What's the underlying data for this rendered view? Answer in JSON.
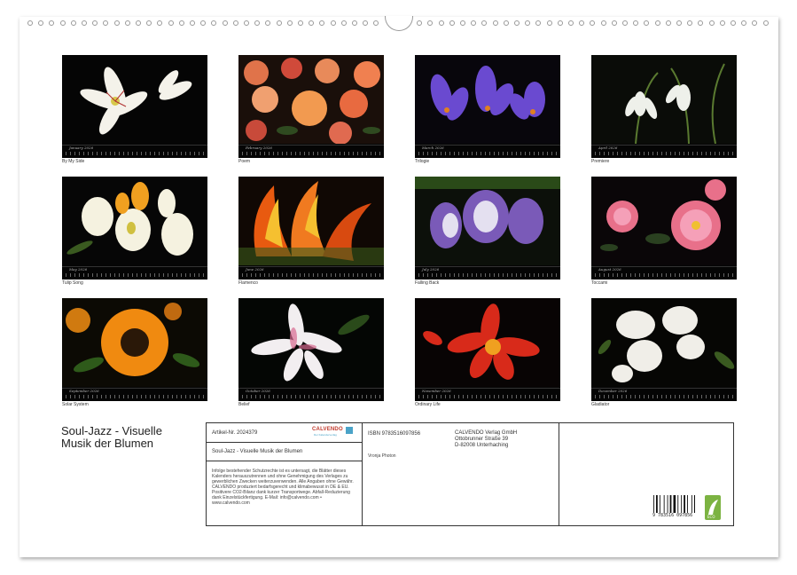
{
  "tiles": [
    {
      "month": "January 2026",
      "label": "By My Side"
    },
    {
      "month": "February 2026",
      "label": "Poem"
    },
    {
      "month": "March 2026",
      "label": "Trilogie"
    },
    {
      "month": "April 2026",
      "label": "Premiere"
    },
    {
      "month": "May 2026",
      "label": "Tulip Song"
    },
    {
      "month": "June 2026",
      "label": "Flamenco"
    },
    {
      "month": "July 2026",
      "label": "Falling Back"
    },
    {
      "month": "August 2026",
      "label": "Toccami"
    },
    {
      "month": "September 2026",
      "label": "Solar System"
    },
    {
      "month": "October 2026",
      "label": "Belief"
    },
    {
      "month": "November 2026",
      "label": "Ordinary Life"
    },
    {
      "month": "December 2026",
      "label": "Gladiator"
    }
  ],
  "title": {
    "line1": "Soul-Jazz - Visuelle",
    "line2": "Musik der Blumen"
  },
  "info": {
    "article": "Artikel-Nr. 2024379",
    "logo": "CALVENDO",
    "logo_sub": "Der Kalenderverlag",
    "product_title": "Soul-Jazz - Visuelle Musik der Blumen",
    "legal": "Infolge bestehender Schutzrechte ist es untersagt, die Blätter dieses Kalenders herauszutrennen und ohne Genehmigung des Verlages zu gewerblichen Zwecken weiterzuverwenden. Alle Angaben ohne Gewähr. CALVENDO produziert bedarfsgerecht und klimabewusst in DE & EU. Positivere CO2-Bilanz dank kurzer Transportwege. Abfall-Reduzierung dank Einzelstückfertigung. E-Mail: info@calvendo.com • www.calvendo.com",
    "isbn": "ISBN 9783516097856",
    "author": "Vronja Photon",
    "publisher_line1": "CALVENDO Verlag GmbH",
    "publisher_line2": "Ottobrunner Straße 39",
    "publisher_line3": "D-82008 Unterhaching",
    "barcode_digits": "9 783516 097856"
  },
  "colors": {
    "accent": "#4aa3c8",
    "eco": "#7cb342"
  }
}
